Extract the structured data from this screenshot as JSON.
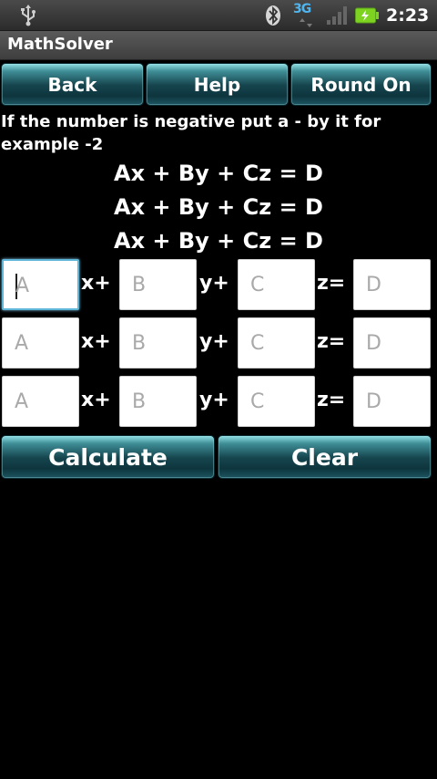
{
  "status_bar": {
    "time": "2:23",
    "network": "3G",
    "icons": [
      "usb-icon",
      "bluetooth-icon",
      "3g-icon",
      "signal-icon",
      "battery-charging-icon"
    ],
    "accent_color": "#4fb5ef",
    "battery_color": "#7ed321"
  },
  "app": {
    "title": "MathSolver"
  },
  "toolbar": {
    "back_label": "Back",
    "help_label": "Help",
    "round_label": "Round On"
  },
  "instruction": "If the number is negative put a - by it for example -2",
  "equation_template": [
    "Ax + By + Cz = D",
    "Ax + By + Cz = D",
    "Ax + By + Cz = D"
  ],
  "operators": {
    "x": "x+",
    "y": "y+",
    "z": "z="
  },
  "rows": [
    {
      "a": "A",
      "b": "B",
      "c": "C",
      "d": "D"
    },
    {
      "a": "A",
      "b": "B",
      "c": "C",
      "d": "D"
    },
    {
      "a": "A",
      "b": "B",
      "c": "C",
      "d": "D"
    }
  ],
  "actions": {
    "calculate_label": "Calculate",
    "clear_label": "Clear"
  }
}
